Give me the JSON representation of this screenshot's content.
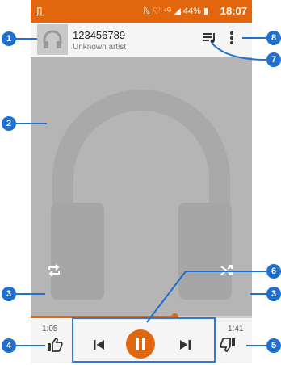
{
  "status_bar": {
    "app_icon": "headphones-icon",
    "indicators": "ℕ ♡ ⁴ᴳ",
    "battery": "44%",
    "time": "18:07"
  },
  "now_playing": {
    "title": "123456789",
    "artist": "Unknown artist"
  },
  "playback": {
    "elapsed": "1:05",
    "total": "1:41",
    "progress": 0.65,
    "state": "playing"
  },
  "colors": {
    "accent": "#e2660e",
    "callout": "#1d6fd1"
  },
  "callouts": {
    "c1": "1",
    "c2": "2",
    "c3a": "3",
    "c3b": "3",
    "c4": "4",
    "c5": "5",
    "c6": "6",
    "c7": "7",
    "c8": "8"
  }
}
